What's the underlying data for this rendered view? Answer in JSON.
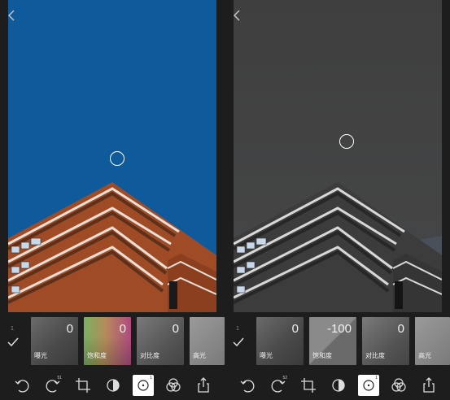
{
  "left": {
    "step_number": "1",
    "tiles": [
      {
        "value": "0",
        "label": "曝光"
      },
      {
        "value": "0",
        "label": "饱和度"
      },
      {
        "value": "0",
        "label": "对比度"
      },
      {
        "value": "",
        "label": "高光"
      }
    ],
    "toolbar_badges": {
      "history": "51",
      "selective": "1"
    }
  },
  "right": {
    "step_number": "1",
    "tiles": [
      {
        "value": "0",
        "label": "曝光"
      },
      {
        "value": "-100",
        "label": "饱和度"
      },
      {
        "value": "0",
        "label": "对比度"
      },
      {
        "value": "",
        "label": "高光"
      }
    ],
    "toolbar_badges": {
      "history": "52",
      "selective": "1"
    }
  },
  "colors": {
    "sky_left": "#0f5a9a",
    "sky_right": "#404142",
    "brick_left": "#9e4b26",
    "brick_right": "#3c3c3c",
    "background": "#1d1d1d"
  },
  "icons": [
    "back-icon",
    "check-icon",
    "undo-icon",
    "history-icon",
    "crop-icon",
    "tone-icon",
    "selective-icon",
    "filter-icon",
    "share-icon"
  ]
}
